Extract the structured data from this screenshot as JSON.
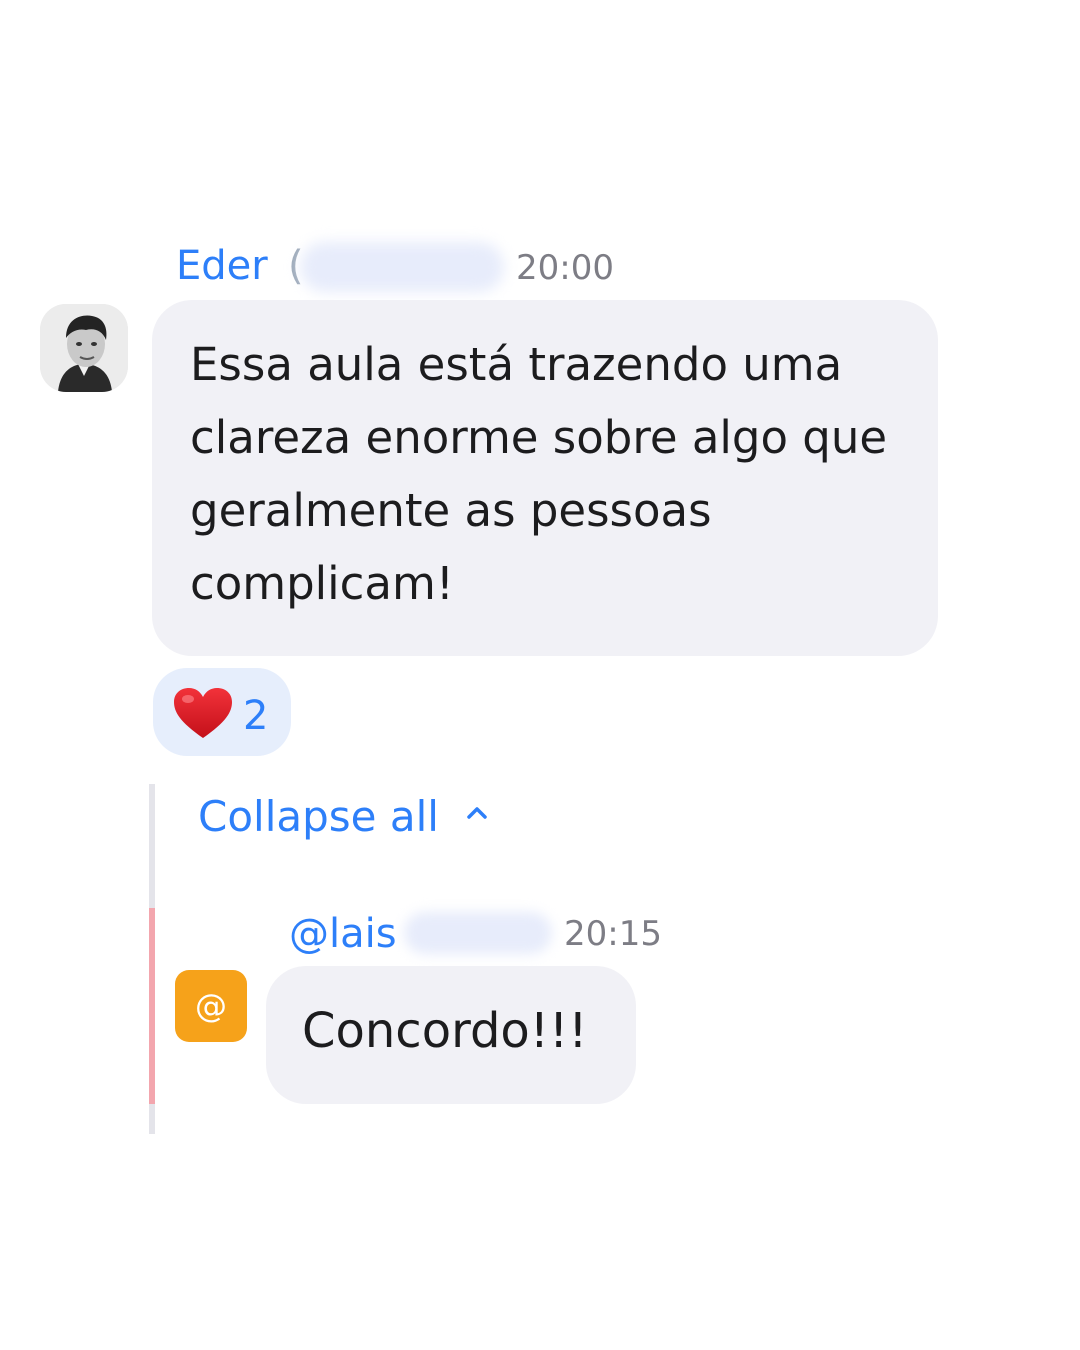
{
  "message": {
    "sender_name": "Eder",
    "sender_name_tail": "(",
    "time": "20:00",
    "text": "Essa aula está trazendo uma clareza enorme sobre algo que geralmente as pessoas complicam!"
  },
  "reaction": {
    "emoji_icon": "heart-icon",
    "count": "2"
  },
  "thread": {
    "collapse_label": "Collapse all",
    "reply": {
      "sender": "@lais",
      "time": "20:15",
      "avatar_glyph": "@",
      "text": "Concordo!!!"
    }
  },
  "colors": {
    "accent": "#2d7ff9",
    "bubble": "#f1f1f6",
    "reaction_bg": "#e6eefc",
    "thread_accent": "#f3a6ae",
    "avatar_orange": "#f6a21a"
  }
}
